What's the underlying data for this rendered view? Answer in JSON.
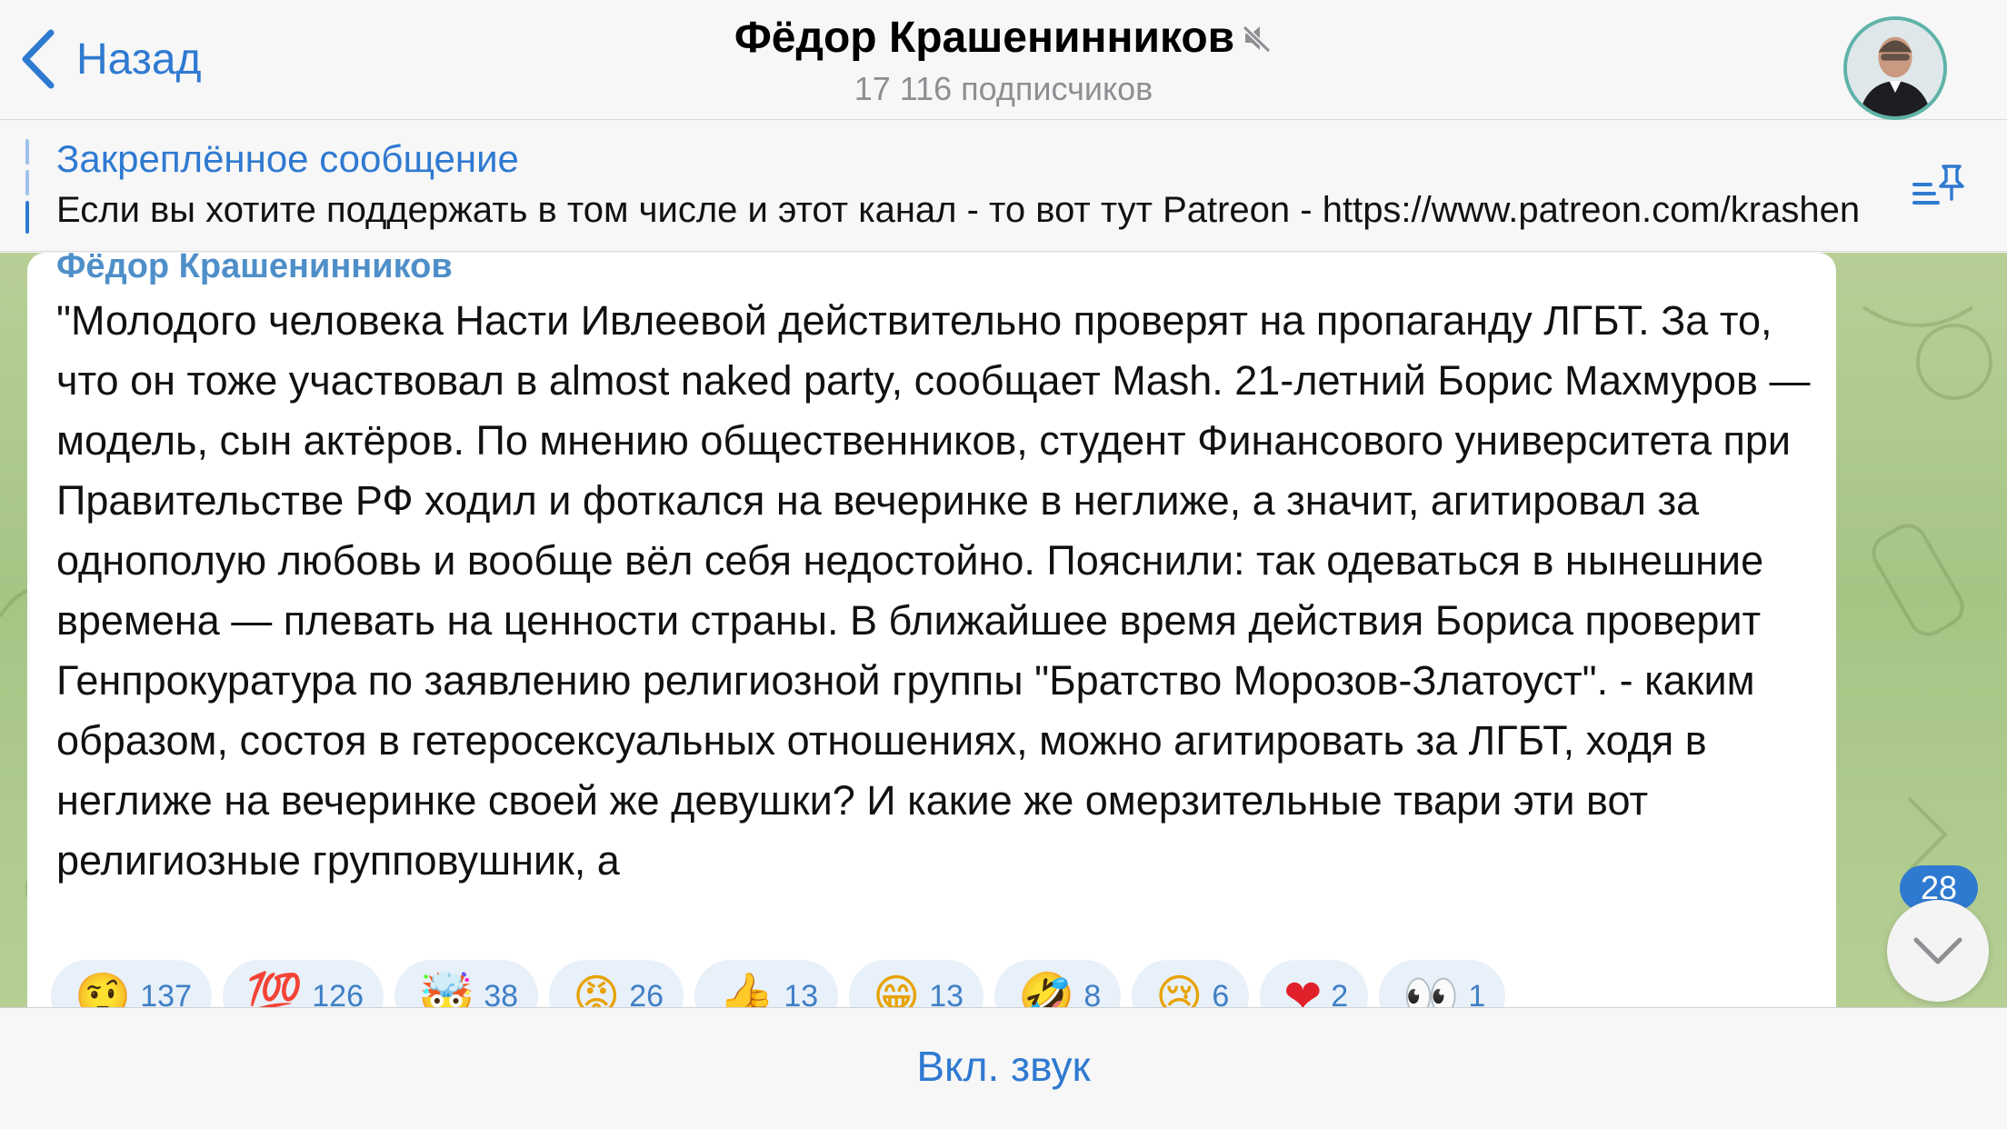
{
  "header": {
    "back_label": "Назад",
    "title": "Фёдор Крашенинников",
    "subtitle": "17 116 подписчиков"
  },
  "pinned": {
    "label": "Закреплённое сообщение",
    "text": "Если вы хотите поддержать в том числе и этот канал - то вот тут Patreon - https://www.patreon.com/krashen"
  },
  "message": {
    "author": "Фёдор Крашенинников",
    "text": "\"Молодого человека Насти Ивлеевой действительно проверят на пропаганду ЛГБТ. За то, что он тоже участвовал в almost naked party, сообщает Mash. 21-летний Борис Махмуров — модель, сын актёров. По мнению общественников, студент Финансового университета при Правительстве РФ ходил и фоткался на вечеринке в неглиже, а значит, агитировал за однополую любовь и вообще вёл себя недостойно. Пояснили: так одеваться в нынешние времена — плевать на ценности страны. В ближайшее время действия Бориса проверит Генпрокуратура по заявлению религиозной группы \"Братство Морозов-Златоуст\".  - каким образом, состоя в гетеросексуальных отношениях, можно агитировать за ЛГБТ, ходя в неглиже на вечеринке своей же девушки? И какие же омерзительные твари эти вот религиозные групповушник, а",
    "reactions": [
      {
        "emoji": "🤨",
        "count": "137"
      },
      {
        "emoji": "💯",
        "count": "126"
      },
      {
        "emoji": "🤯",
        "count": "38"
      },
      {
        "emoji": "😡",
        "count": "26"
      },
      {
        "emoji": "👍",
        "count": "13"
      },
      {
        "emoji": "😁",
        "count": "13"
      },
      {
        "emoji": "🤣",
        "count": "8"
      },
      {
        "emoji": "😢",
        "count": "6"
      },
      {
        "emoji": "❤",
        "count": "2"
      },
      {
        "emoji": "👀",
        "count": "1"
      }
    ]
  },
  "unread_badge": "28",
  "bottom": {
    "unmute_label": "Вкл. звук"
  },
  "colors": {
    "accent": "#2f7ad1",
    "chat_bg": "#a6c585"
  }
}
